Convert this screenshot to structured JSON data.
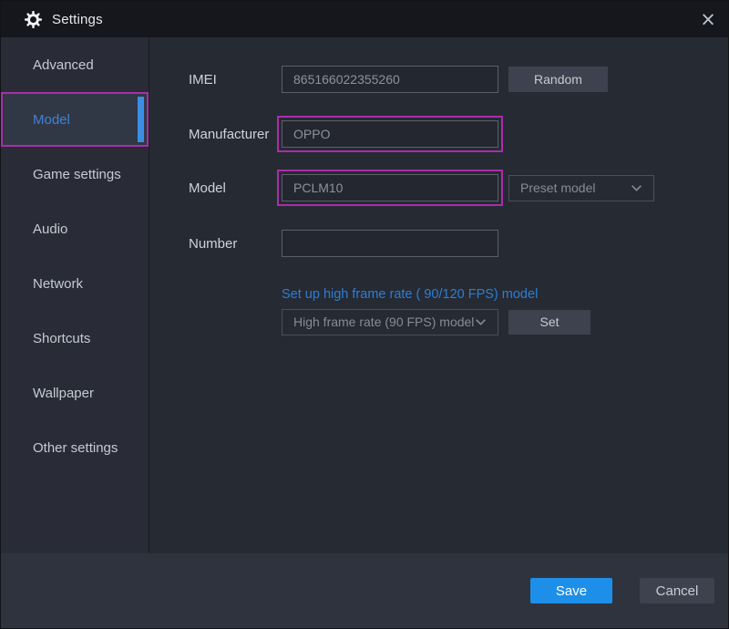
{
  "titlebar": {
    "title": "Settings",
    "close_glyph": "×"
  },
  "sidebar": {
    "items": [
      {
        "label": "Advanced"
      },
      {
        "label": "Model",
        "selected": true
      },
      {
        "label": "Game settings"
      },
      {
        "label": "Audio"
      },
      {
        "label": "Network"
      },
      {
        "label": "Shortcuts"
      },
      {
        "label": "Wallpaper"
      },
      {
        "label": "Other settings"
      }
    ]
  },
  "form": {
    "imei": {
      "label": "IMEI",
      "value": "865166022355260",
      "random_button": "Random"
    },
    "manufacturer": {
      "label": "Manufacturer",
      "value": "OPPO",
      "highlighted": true
    },
    "model": {
      "label": "Model",
      "value": "PCLM10",
      "highlighted": true,
      "preset_dropdown": "Preset model"
    },
    "number": {
      "label": "Number",
      "value": ""
    },
    "high_frame_rate": {
      "link_text": "Set up high frame rate ( 90/120 FPS) model",
      "dropdown_value": "High frame rate (90 FPS) model",
      "set_button": "Set"
    }
  },
  "footer": {
    "save_label": "Save",
    "cancel_label": "Cancel"
  },
  "colors": {
    "accent_blue": "#1e8fe8",
    "link_blue": "#2d7ed3",
    "selected_item_blue": "#3f82d6",
    "highlight_magenta": "#aa2daa",
    "titlebar_bg": "#15171d",
    "panel_bg": "#262a33",
    "footer_bg": "#2f333e"
  }
}
